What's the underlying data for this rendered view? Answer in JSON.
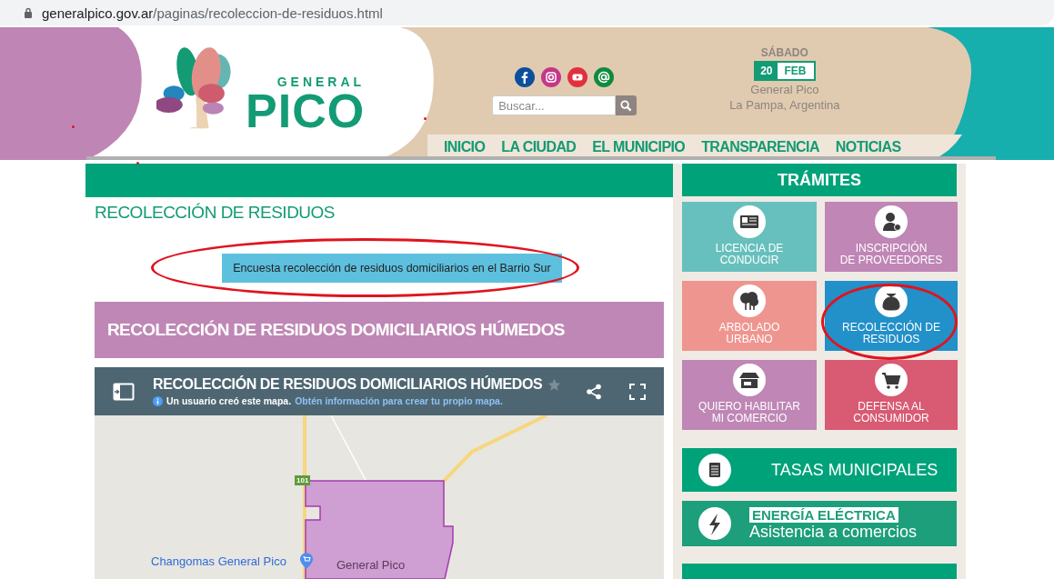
{
  "browser": {
    "domain": "generalpico.gov.ar",
    "path": "/paginas/recoleccion-de-residuos.html"
  },
  "header": {
    "logo_small": "GENERAL",
    "logo_big": "PICO",
    "search": {
      "placeholder": "Buscar..."
    },
    "date": {
      "weekday": "SÁBADO",
      "day": "20",
      "month": "FEB"
    },
    "location": [
      "General Pico",
      "La Pampa, Argentina"
    ],
    "nav": [
      {
        "label": "INICIO"
      },
      {
        "label": "LA CIUDAD"
      },
      {
        "label": "EL MUNICIPIO"
      },
      {
        "label": "TRANSPARENCIA"
      },
      {
        "label": "NOTICIAS"
      }
    ]
  },
  "content": {
    "title": "RECOLECCIÓN DE RESIDUOS",
    "survey_button": "Encuesta recolección de residuos domiciliarios en el Barrio Sur",
    "banner": "RECOLECCIÓN DE RESIDUOS DOMICILIARIOS HÚMEDOS",
    "map": {
      "title": "RECOLECCIÓN DE RESIDUOS DOMICILIARIOS HÚMEDOS",
      "info": "Un usuario creó este mapa.",
      "link": "Obtén información para crear tu propio mapa.",
      "route": "101",
      "place": "Changomas General Pico",
      "city": "General Pico"
    }
  },
  "sidebar": {
    "title": "TRÁMITES",
    "tiles": [
      {
        "kind": "license",
        "lines": [
          "LICENCIA DE",
          "CONDUCIR"
        ],
        "color": "#67c0bd"
      },
      {
        "kind": "person",
        "lines": [
          "INSCRIPCIÓN",
          "DE PROVEEDORES"
        ],
        "color": "#bf86b6"
      },
      {
        "kind": "tree",
        "lines": [
          "ARBOLADO",
          "URBANO"
        ],
        "color": "#ef958f"
      },
      {
        "kind": "bag",
        "lines": [
          "RECOLECCIÓN DE",
          "RESIDUOS"
        ],
        "color": "#2290c9"
      },
      {
        "kind": "shop",
        "lines": [
          "QUIERO HABILITAR",
          "MI COMERCIO"
        ],
        "color": "#bf86b6"
      },
      {
        "kind": "cart",
        "lines": [
          "DEFENSA AL",
          "CONSUMIDOR"
        ],
        "color": "#d85a73"
      }
    ],
    "banners": [
      {
        "kind": "plain",
        "label": "TASAS MUNICIPALES"
      },
      {
        "kind": "tagged",
        "tag": "ENERGÍA ELÉCTRICA",
        "label": "Asistencia a comercios"
      }
    ]
  }
}
